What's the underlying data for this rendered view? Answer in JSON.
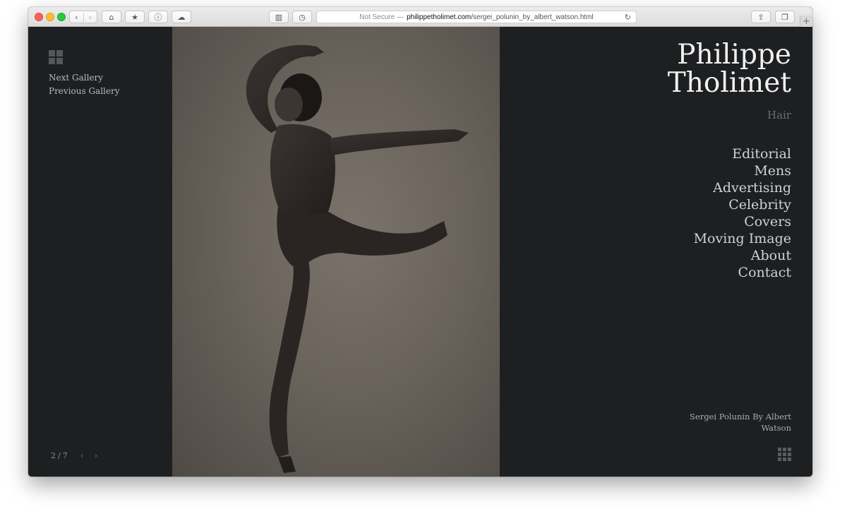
{
  "browser": {
    "url_prefix": "Not Secure —",
    "url_host": "philippetholimet.com",
    "url_path": "/sergei_polunin_by_albert_watson.html",
    "back_icon": "‹",
    "forward_icon": "›",
    "home_icon": "⌂",
    "bookmark_icon": "★",
    "info_icon": "ⓘ",
    "cloud_icon": "☁",
    "sidebar_icon": "▥",
    "history_icon": "◷",
    "reload_icon": "↻",
    "share_icon": "⇪",
    "tabs_icon": "❐",
    "newtab_icon": "+"
  },
  "site": {
    "name_line1": "Philippe",
    "name_line2": "Tholimet",
    "subtitle": "Hair"
  },
  "gallery_nav": {
    "next": "Next Gallery",
    "previous": "Previous Gallery"
  },
  "main_nav": [
    {
      "label": "Editorial"
    },
    {
      "label": "Mens"
    },
    {
      "label": "Advertising"
    },
    {
      "label": "Celebrity"
    },
    {
      "label": "Covers"
    },
    {
      "label": "Moving Image"
    },
    {
      "label": "About"
    },
    {
      "label": "Contact"
    }
  ],
  "photo": {
    "caption": "Sergei Polunin By Albert Watson"
  },
  "counter": {
    "current": "2",
    "separator": "/",
    "total": "7",
    "prev_arrow": "‹",
    "next_arrow": "›"
  },
  "colors": {
    "page_bg": "#1d1f21",
    "photo_bg": "#6a635c",
    "brand_text": "#f0f0f0",
    "nav_text": "#cfd1d3"
  }
}
